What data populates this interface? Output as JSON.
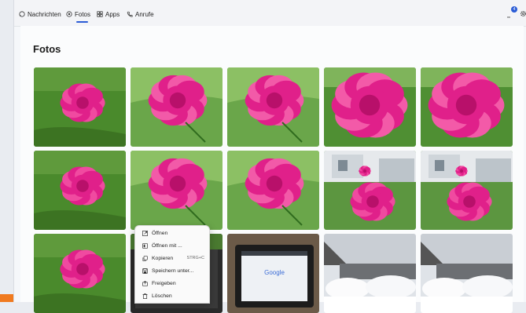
{
  "nav": {
    "tabs": [
      {
        "label": "Nachrichten",
        "icon": "chat-icon"
      },
      {
        "label": "Fotos",
        "icon": "photos-icon",
        "active": true
      },
      {
        "label": "Apps",
        "icon": "apps-icon"
      },
      {
        "label": "Anrufe",
        "icon": "phone-icon"
      }
    ],
    "notification_count": "4"
  },
  "page": {
    "title": "Fotos"
  },
  "photos": [
    {
      "kind": "peony-grass"
    },
    {
      "kind": "peony-close"
    },
    {
      "kind": "peony-close"
    },
    {
      "kind": "peony-big"
    },
    {
      "kind": "peony-big"
    },
    {
      "kind": "peony-grass"
    },
    {
      "kind": "peony-close"
    },
    {
      "kind": "peony-close"
    },
    {
      "kind": "peony-house"
    },
    {
      "kind": "peony-house"
    },
    {
      "kind": "peony-grass"
    },
    {
      "kind": "selected-dark"
    },
    {
      "kind": "tablet-google"
    },
    {
      "kind": "snow"
    },
    {
      "kind": "snow"
    }
  ],
  "tablet": {
    "logo_text": "Google"
  },
  "context_menu": {
    "items": [
      {
        "label": "Öffnen",
        "icon": "open-icon"
      },
      {
        "label": "Öffnen mit ...",
        "icon": "open-with-icon"
      },
      {
        "label": "Kopieren",
        "icon": "copy-icon",
        "shortcut": "STRG+C"
      },
      {
        "label": "Speichern unter...",
        "icon": "save-icon"
      },
      {
        "label": "Freigeben",
        "icon": "share-icon"
      },
      {
        "label": "Löschen",
        "icon": "delete-icon"
      }
    ]
  },
  "colors": {
    "accent": "#2b5cd6",
    "peony": "#e0208a",
    "grass": "#4a8a2c"
  }
}
